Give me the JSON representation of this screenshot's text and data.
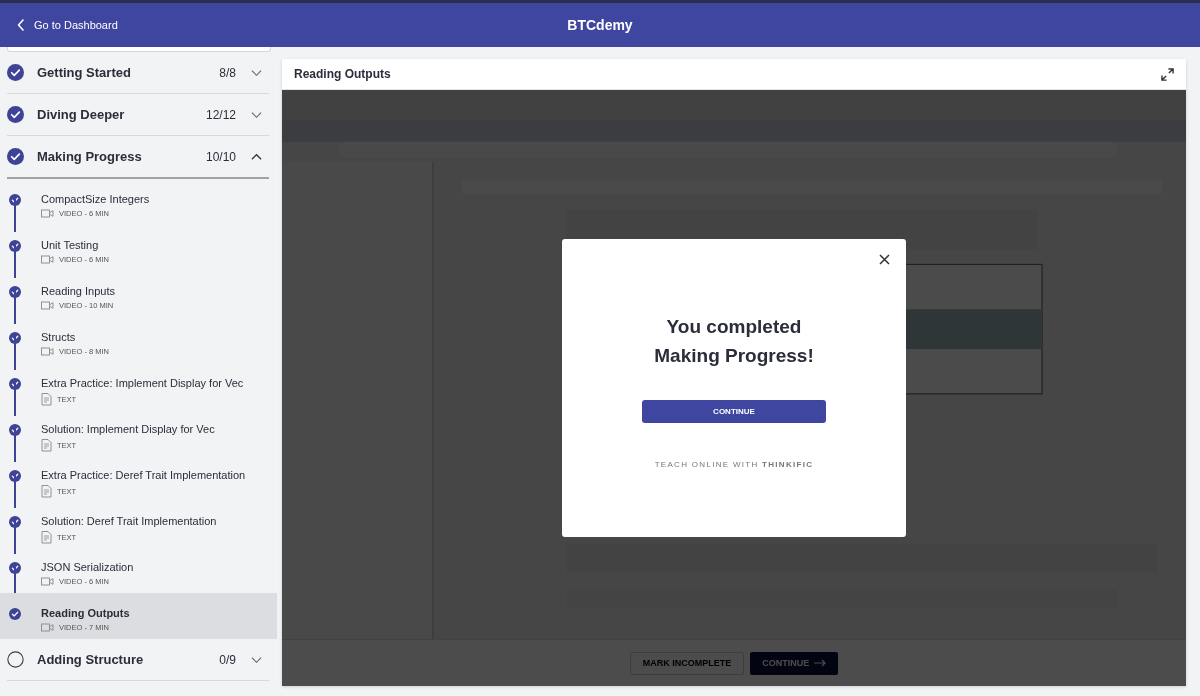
{
  "header": {
    "back_link": "Go to Dashboard",
    "title": "BTCdemy"
  },
  "sidebar": {
    "sections": [
      {
        "title": "Getting Started",
        "count": "8/8",
        "completed": true,
        "expanded": false
      },
      {
        "title": "Diving Deeper",
        "count": "12/12",
        "completed": true,
        "expanded": false
      },
      {
        "title": "Making Progress",
        "count": "10/10",
        "completed": true,
        "expanded": true,
        "lessons": [
          {
            "title": "CompactSize Integers",
            "kind": "video",
            "meta": "VIDEO - 6 MIN",
            "completed": true,
            "selected": false
          },
          {
            "title": "Unit Testing",
            "kind": "video",
            "meta": "VIDEO - 6 MIN",
            "completed": true,
            "selected": false
          },
          {
            "title": "Reading Inputs",
            "kind": "video",
            "meta": "VIDEO - 10 MIN",
            "completed": true,
            "selected": false
          },
          {
            "title": "Structs",
            "kind": "video",
            "meta": "VIDEO - 8 MIN",
            "completed": true,
            "selected": false
          },
          {
            "title": "Extra Practice: Implement Display for Vec",
            "kind": "text",
            "meta": "TEXT",
            "completed": true,
            "selected": false
          },
          {
            "title": "Solution: Implement Display for Vec",
            "kind": "text",
            "meta": "TEXT",
            "completed": true,
            "selected": false
          },
          {
            "title": "Extra Practice: Deref Trait Implementation",
            "kind": "text",
            "meta": "TEXT",
            "completed": true,
            "selected": false
          },
          {
            "title": "Solution: Deref Trait Implementation",
            "kind": "text",
            "meta": "TEXT",
            "completed": true,
            "selected": false
          },
          {
            "title": "JSON Serialization",
            "kind": "video",
            "meta": "VIDEO - 6 MIN",
            "completed": true,
            "selected": false
          },
          {
            "title": "Reading Outputs",
            "kind": "video",
            "meta": "VIDEO - 7 MIN",
            "completed": true,
            "selected": true
          }
        ]
      },
      {
        "title": "Adding Structure",
        "count": "0/9",
        "completed": false,
        "expanded": false
      }
    ]
  },
  "main": {
    "lesson_title": "Reading Outputs",
    "footer": {
      "mark_incomplete": "MARK INCOMPLETE",
      "continue": "CONTINUE"
    }
  },
  "modal": {
    "heading_line_1": "You completed",
    "heading_line_2": "Making Progress!",
    "button": "CONTINUE",
    "branding": "TEACH ONLINE WITH **THINKIFIC**"
  }
}
